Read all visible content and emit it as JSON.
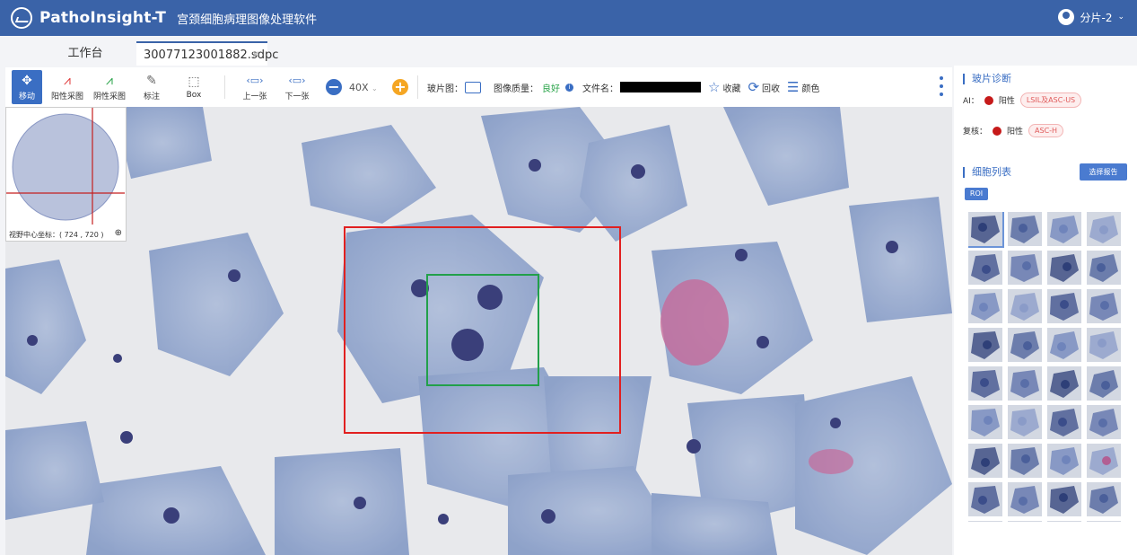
{
  "header": {
    "logo_text": "PathoInsight-T",
    "app_title": "宫颈细胞病理图像处理软件",
    "user_label": "分片-2"
  },
  "tabs": [
    {
      "label": "工作台"
    },
    {
      "label": "30077123001882.sdpc"
    }
  ],
  "toolbar": {
    "tools": [
      {
        "label": "移动",
        "icon": "move-icon"
      },
      {
        "label": "阳性采图",
        "icon": "positive-capture-icon"
      },
      {
        "label": "阴性采图",
        "icon": "negative-capture-icon"
      },
      {
        "label": "标注",
        "icon": "annotate-icon"
      },
      {
        "label": "Box",
        "icon": "box-select-icon"
      },
      {
        "label": "上一张",
        "icon": "prev-slide-icon"
      },
      {
        "label": "下一张",
        "icon": "next-slide-icon"
      }
    ],
    "zoom_value": "40X",
    "thumbnail_label": "玻片图：",
    "quality_label": "图像质量：",
    "quality_value": "良好",
    "filename_label": "文件名：",
    "collect_label": "收藏",
    "recycle_label": "回收",
    "color_label": "颜色"
  },
  "overview": {
    "coord_text": "视野中心坐标：( 724 , 720 )"
  },
  "right_panel": {
    "diagnosis_title": "玻片诊断",
    "ai_label": "AI：",
    "ai_result": "阳性",
    "ai_tag": "LSIL及ASC-US",
    "review_label": "复核：",
    "review_result": "阳性",
    "review_tag": "ASC-H",
    "cell_list_title": "细胞列表",
    "report_button": "选择报告",
    "roi_label": "ROI"
  },
  "colors": {
    "brand": "#3a63a8",
    "accent": "#3a6ec3",
    "positive": "#c61a1a",
    "quality_good": "#2aa44a",
    "zoom_plus": "#f5a623"
  }
}
